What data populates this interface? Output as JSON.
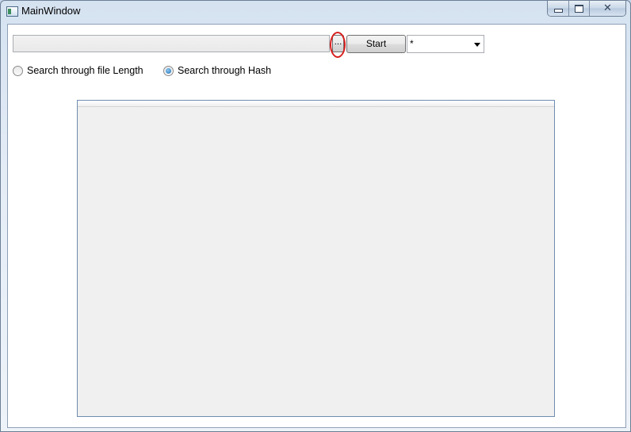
{
  "window": {
    "title": "MainWindow"
  },
  "toolbar": {
    "path_value": "",
    "browse_label": "...",
    "start_label": "Start",
    "filter_value": "*"
  },
  "options": {
    "length_label": "Search through file Length",
    "hash_label": "Search through Hash",
    "selected": "hash"
  },
  "results_grid": {
    "rows": []
  },
  "colors": {
    "annotation": "#d71f1f",
    "radio_accent": "#1f6fb3"
  },
  "icons": [
    "app-icon",
    "minimize-icon",
    "maximize-icon",
    "close-icon",
    "chevron-down-icon"
  ]
}
